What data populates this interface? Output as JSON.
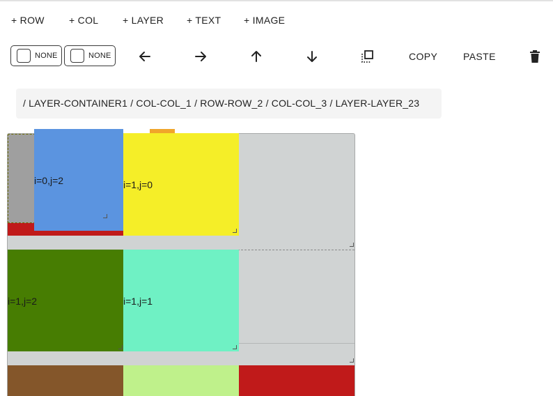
{
  "toolbar": {
    "add_row": "+ ROW",
    "add_col": "+ COL",
    "add_layer": "+ LAYER",
    "add_text": "+ TEXT",
    "add_image": "+ IMAGE"
  },
  "controls": {
    "toggle_1_label": "NONE",
    "toggle_2_label": "NONE",
    "icons": [
      "arrow-left-icon",
      "arrow-right-icon",
      "arrow-up-icon",
      "arrow-down-icon",
      "select-layer-icon",
      "trash-icon"
    ],
    "copy_label": "COPY",
    "paste_label": "PASTE"
  },
  "breadcrumb": [
    "/ LAYER-CONTAINER1",
    "/ COL-COL_1",
    "/ ROW-ROW_2",
    "/ COL-COL_3",
    "/ LAYER-LAYER_23"
  ],
  "canvas": {
    "cells": [
      {
        "label": "i=0,j=2",
        "color": "#5b94e0"
      },
      {
        "label": "i=1,j=0",
        "color": "#f5ee28"
      },
      {
        "label": "i=1,j=2",
        "color": "#477d02"
      },
      {
        "label": "i=1,j=1",
        "color": "#6ff1c4"
      }
    ],
    "colors": {
      "background": "#d0d3d3",
      "gray_block": "#9f9f9f",
      "red": "#c01a1a",
      "orange": "#f0a52b",
      "brown": "#84562a",
      "light_green": "#bff18b"
    }
  }
}
